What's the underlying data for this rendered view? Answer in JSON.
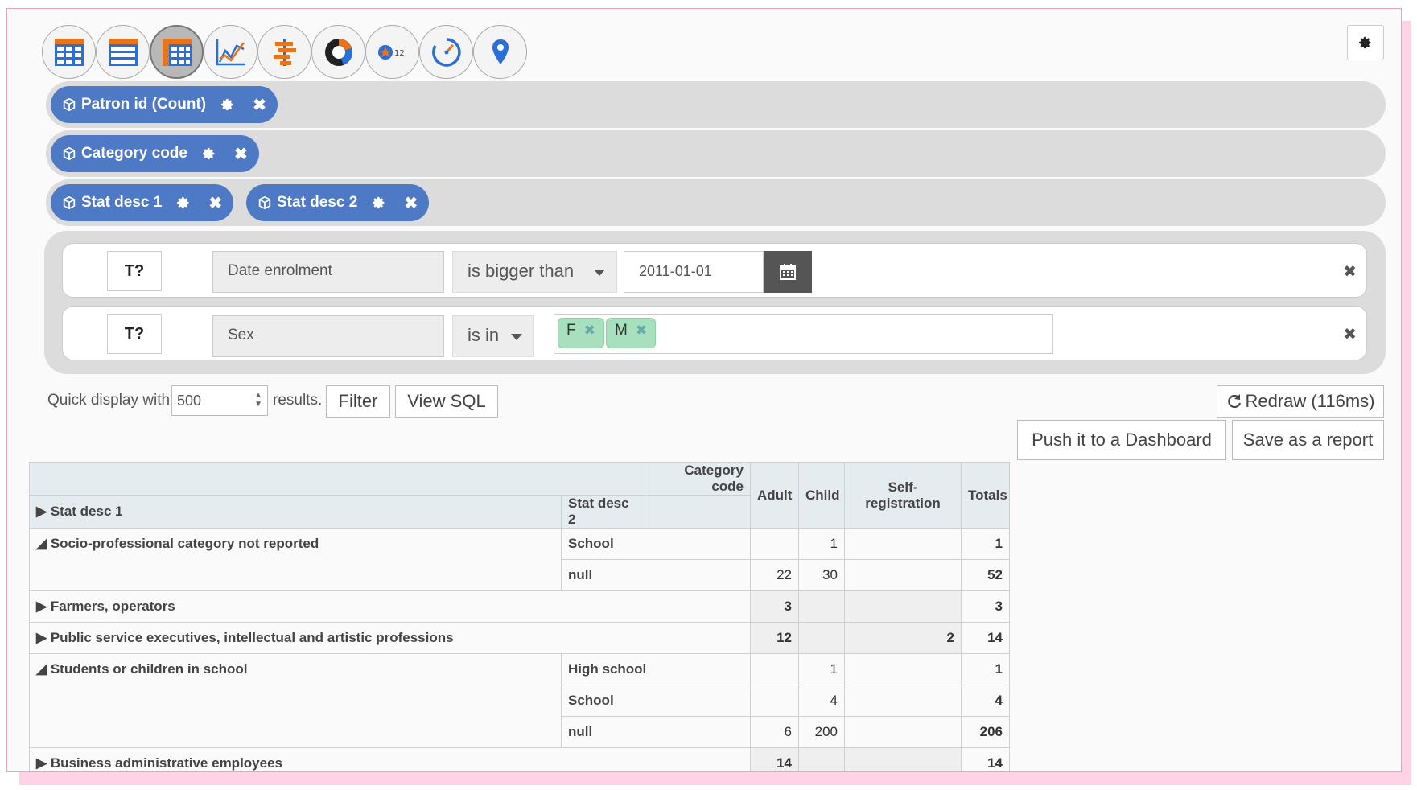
{
  "toolbar": {
    "items": [
      {
        "name": "table-view-icon"
      },
      {
        "name": "list-view-icon"
      },
      {
        "name": "pivot-table-icon",
        "active": true
      },
      {
        "name": "line-chart-icon"
      },
      {
        "name": "bar-chart-icon"
      },
      {
        "name": "pie-chart-icon"
      },
      {
        "name": "kpi-icon",
        "text": "12"
      },
      {
        "name": "gauge-icon"
      },
      {
        "name": "map-pin-icon"
      }
    ]
  },
  "zones": {
    "measures": [
      {
        "label": "Patron id (Count)"
      }
    ],
    "columns": [
      {
        "label": "Category code"
      }
    ],
    "rows": [
      {
        "label": "Stat desc 1"
      },
      {
        "label": "Stat desc 2"
      }
    ]
  },
  "filters": [
    {
      "funnel": "T?",
      "field": "Date enrolment",
      "operator": "is bigger than",
      "value": "2011-01-01"
    },
    {
      "funnel": "T?",
      "field": "Sex",
      "operator": "is in",
      "tags": [
        "F",
        "M"
      ]
    }
  ],
  "quick": {
    "prefix": "Quick display with",
    "value": "500",
    "suffix": "results.",
    "filter_label": "Filter",
    "sql_label": "View SQL",
    "redraw_label": "Redraw (116ms)",
    "dashboard_label": "Push it to a Dashboard",
    "report_label": "Save as a report"
  },
  "table": {
    "col_dimension": "Category code",
    "row_dim_1": "Stat desc 1",
    "row_dim_2": "Stat desc 2",
    "columns": [
      "Adult",
      "Child",
      "Self-registration",
      "Totals"
    ],
    "groups": [
      {
        "label": "Socio-professional category not reported",
        "expanded": true,
        "rows": [
          {
            "sub": "School",
            "adult": "",
            "child": "1",
            "self": "",
            "total": "1"
          },
          {
            "sub": "null",
            "adult": "22",
            "child": "30",
            "self": "",
            "total": "52"
          }
        ]
      },
      {
        "label": "Farmers, operators",
        "expanded": false,
        "summary": {
          "adult": "3",
          "child": "",
          "self": "",
          "total": "3"
        }
      },
      {
        "label": "Public service executives, intellectual and artistic professions",
        "expanded": false,
        "summary": {
          "adult": "12",
          "child": "",
          "self": "2",
          "total": "14"
        }
      },
      {
        "label": "Students or children in school",
        "expanded": true,
        "rows": [
          {
            "sub": "High school",
            "adult": "",
            "child": "1",
            "self": "",
            "total": "1"
          },
          {
            "sub": "School",
            "adult": "",
            "child": "4",
            "self": "",
            "total": "4"
          },
          {
            "sub": "null",
            "adult": "6",
            "child": "200",
            "self": "",
            "total": "206"
          }
        ]
      },
      {
        "label": "Business administrative employees",
        "expanded": false,
        "summary": {
          "adult": "14",
          "child": "",
          "self": "",
          "total": "14"
        }
      }
    ]
  },
  "colors": {
    "pill": "#4e79c4",
    "header": "#e5ecef",
    "tag": "#a8e0be"
  }
}
